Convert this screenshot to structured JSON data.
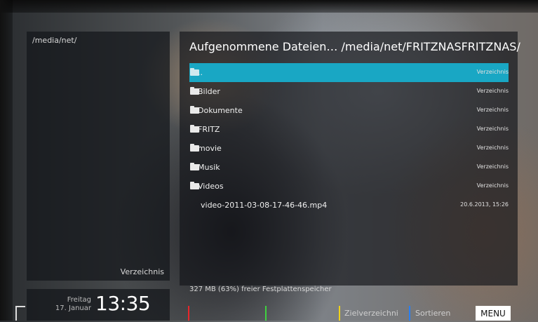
{
  "left_panel": {
    "path": "/media/net/",
    "type_label": "Verzeichnis"
  },
  "clock": {
    "weekday": "Freitag",
    "date": "17. Januar",
    "time": "13:35"
  },
  "main": {
    "title": "Aufgenommene Dateien…  /media/net/FRITZNASFRITZNAS/",
    "files": [
      {
        "name": "..",
        "type": "Verzeichnis",
        "icon": "folder-icon",
        "selected": true
      },
      {
        "name": "Bilder",
        "type": "Verzeichnis",
        "icon": "folder-icon"
      },
      {
        "name": "Dokumente",
        "type": "Verzeichnis",
        "icon": "folder-icon"
      },
      {
        "name": "FRITZ",
        "type": "Verzeichnis",
        "icon": "folder-icon"
      },
      {
        "name": "movie",
        "type": "Verzeichnis",
        "icon": "folder-icon"
      },
      {
        "name": "Musik",
        "type": "Verzeichnis",
        "icon": "folder-icon"
      },
      {
        "name": "Videos",
        "type": "Verzeichnis",
        "icon": "folder-icon"
      },
      {
        "name": "video-2011-03-08-17-46-46.mp4",
        "type": "20.6.2013, 15:26",
        "icon": ""
      }
    ],
    "free_space": "327 MB (63%) freier Festplattenspeicher"
  },
  "buttons": {
    "red_label": "",
    "green_label": "",
    "yellow_label": "Zielverzeichni",
    "blue_label": "Sortieren",
    "menu_label": "MENU"
  },
  "colors": {
    "selection": "#19a7c4",
    "red": "#e8262a",
    "green": "#3fd13f",
    "yellow": "#f0d21a",
    "blue": "#2a7ff0"
  }
}
